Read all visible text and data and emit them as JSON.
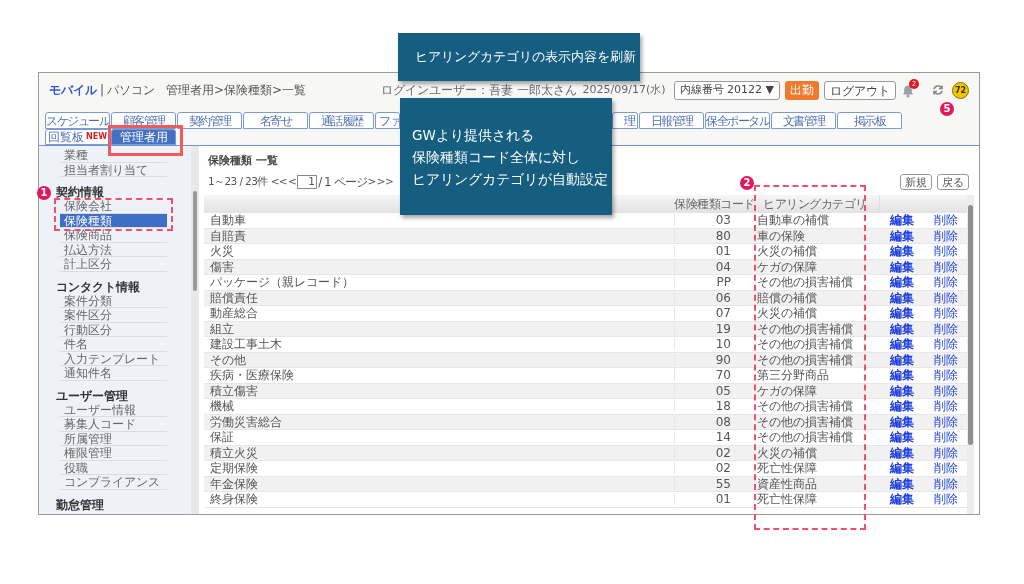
{
  "breadcrumb": {
    "mobile": "モバイル",
    "separator": "|",
    "pc": "パソコン",
    "path": "管理者用>保険種類>一覧"
  },
  "header": {
    "login_user": "ログインユーザー：吾妻 一郎太さん",
    "date": "2025/09/17(水)",
    "extension": "内線番号 20122 ▼",
    "clock_in": "出勤",
    "logout": "ログアウト",
    "notification_count": "2",
    "points": "72"
  },
  "tabs_row1": [
    {
      "label": "スケジュール",
      "kind": "tab",
      "selected": false
    },
    {
      "label": "顧客管理",
      "kind": "tab",
      "selected": false
    },
    {
      "label": "契約管理",
      "kind": "tab",
      "selected": false
    },
    {
      "label": "名寄せ",
      "kind": "tab",
      "selected": false
    },
    {
      "label": "通話履歴",
      "kind": "tab",
      "selected": false
    },
    {
      "label": "ファ",
      "kind": "cut",
      "selected": false
    },
    {
      "label": "理",
      "kind": "cut",
      "selected": false
    },
    {
      "label": "日報管理",
      "kind": "tab",
      "selected": false
    },
    {
      "label": "保全ポータル",
      "kind": "tab",
      "selected": false
    },
    {
      "label": "文書管理",
      "kind": "tab",
      "selected": false
    },
    {
      "label": "掲示板",
      "kind": "tab",
      "selected": false
    }
  ],
  "tabs_row2": [
    {
      "label": "回覧板",
      "badge": "NEW",
      "selected": false
    },
    {
      "label": "管理者用",
      "selected": true
    }
  ],
  "sidebar": [
    {
      "items": [
        {
          "label": "業種",
          "selected": false
        },
        {
          "label": "担当者割り当て",
          "selected": false
        }
      ]
    },
    {
      "heading": "契約情報",
      "items": [
        {
          "label": "保険会社",
          "selected": false
        },
        {
          "label": "保険種類",
          "selected": true
        },
        {
          "label": "保険商品",
          "selected": false
        },
        {
          "label": "払込方法",
          "selected": false
        },
        {
          "label": "計上区分",
          "selected": false
        }
      ]
    },
    {
      "heading": "コンタクト情報",
      "items": [
        {
          "label": "案件分類",
          "selected": false
        },
        {
          "label": "案件区分",
          "selected": false
        },
        {
          "label": "行動区分",
          "selected": false
        },
        {
          "label": "件名",
          "selected": false
        },
        {
          "label": "入力テンプレート",
          "selected": false
        },
        {
          "label": "通知件名",
          "selected": false
        }
      ]
    },
    {
      "heading": "ユーザー管理",
      "items": [
        {
          "label": "ユーザー情報",
          "selected": false
        },
        {
          "label": "募集人コード",
          "selected": false
        },
        {
          "label": "所属管理",
          "selected": false
        },
        {
          "label": "権限管理",
          "selected": false
        },
        {
          "label": "役職",
          "selected": false
        },
        {
          "label": "コンプライアンス",
          "selected": false
        }
      ]
    },
    {
      "heading": "勤怠管理"
    }
  ],
  "page_title": "保険種類 一覧",
  "pagination": {
    "range": "1～23 / 23件",
    "first": "<<",
    "prev": "<",
    "page": "1",
    "total": "/ 1 ページ",
    "next": ">",
    "last": ">>"
  },
  "buttons": [
    "新規",
    "戻る"
  ],
  "table": {
    "columns": [
      "保険種類コード",
      "ヒアリングカテゴリ"
    ],
    "rows": [
      {
        "name": "自動車",
        "code": "03",
        "category": "自動車の補償",
        "edit": "編集",
        "delete": "削除"
      },
      {
        "name": "自賠責",
        "code": "80",
        "category": "車の保険",
        "edit": "編集",
        "delete": "削除"
      },
      {
        "name": "火災",
        "code": "01",
        "category": "火災の補償",
        "edit": "編集",
        "delete": "削除"
      },
      {
        "name": "傷害",
        "code": "04",
        "category": "ケガの保障",
        "edit": "編集",
        "delete": "削除"
      },
      {
        "name": "パッケージ（親レコード）",
        "code": "PP",
        "category": "その他の損害補償",
        "edit": "編集",
        "delete": "削除"
      },
      {
        "name": "賠償責任",
        "code": "06",
        "category": "賠償の補償",
        "edit": "編集",
        "delete": "削除"
      },
      {
        "name": "動産総合",
        "code": "07",
        "category": "火災の補償",
        "edit": "編集",
        "delete": "削除"
      },
      {
        "name": "組立",
        "code": "19",
        "category": "その他の損害補償",
        "edit": "編集",
        "delete": "削除"
      },
      {
        "name": "建設工事土木",
        "code": "10",
        "category": "その他の損害補償",
        "edit": "編集",
        "delete": "削除"
      },
      {
        "name": "その他",
        "code": "90",
        "category": "その他の損害補償",
        "edit": "編集",
        "delete": "削除"
      },
      {
        "name": "疾病・医療保険",
        "code": "70",
        "category": "第三分野商品",
        "edit": "編集",
        "delete": "削除"
      },
      {
        "name": "積立傷害",
        "code": "05",
        "category": "ケガの保障",
        "edit": "編集",
        "delete": "削除"
      },
      {
        "name": "機械",
        "code": "18",
        "category": "その他の損害補償",
        "edit": "編集",
        "delete": "削除"
      },
      {
        "name": "労働災害総合",
        "code": "08",
        "category": "その他の損害補償",
        "edit": "編集",
        "delete": "削除"
      },
      {
        "name": "保証",
        "code": "14",
        "category": "その他の損害補償",
        "edit": "編集",
        "delete": "削除"
      },
      {
        "name": "積立火災",
        "code": "02",
        "category": "火災の補償",
        "edit": "編集",
        "delete": "削除"
      },
      {
        "name": "定期保険",
        "code": "02",
        "category": "死亡性保障",
        "edit": "編集",
        "delete": "削除"
      },
      {
        "name": "年金保険",
        "code": "55",
        "category": "資産性商品",
        "edit": "編集",
        "delete": "削除"
      },
      {
        "name": "終身保険",
        "code": "01",
        "category": "死亡性保障",
        "edit": "編集",
        "delete": "削除"
      }
    ]
  },
  "annotations": {
    "callouts": [
      {
        "lines": [
          "ヒアリングカテゴリの表示内容を刷新"
        ]
      },
      {
        "lines": [
          "GWより提供される",
          "保険種類コード全体に対し",
          "ヒアリングカテゴリが自動設定"
        ]
      }
    ],
    "markers": [
      "1",
      "2",
      "5"
    ]
  }
}
